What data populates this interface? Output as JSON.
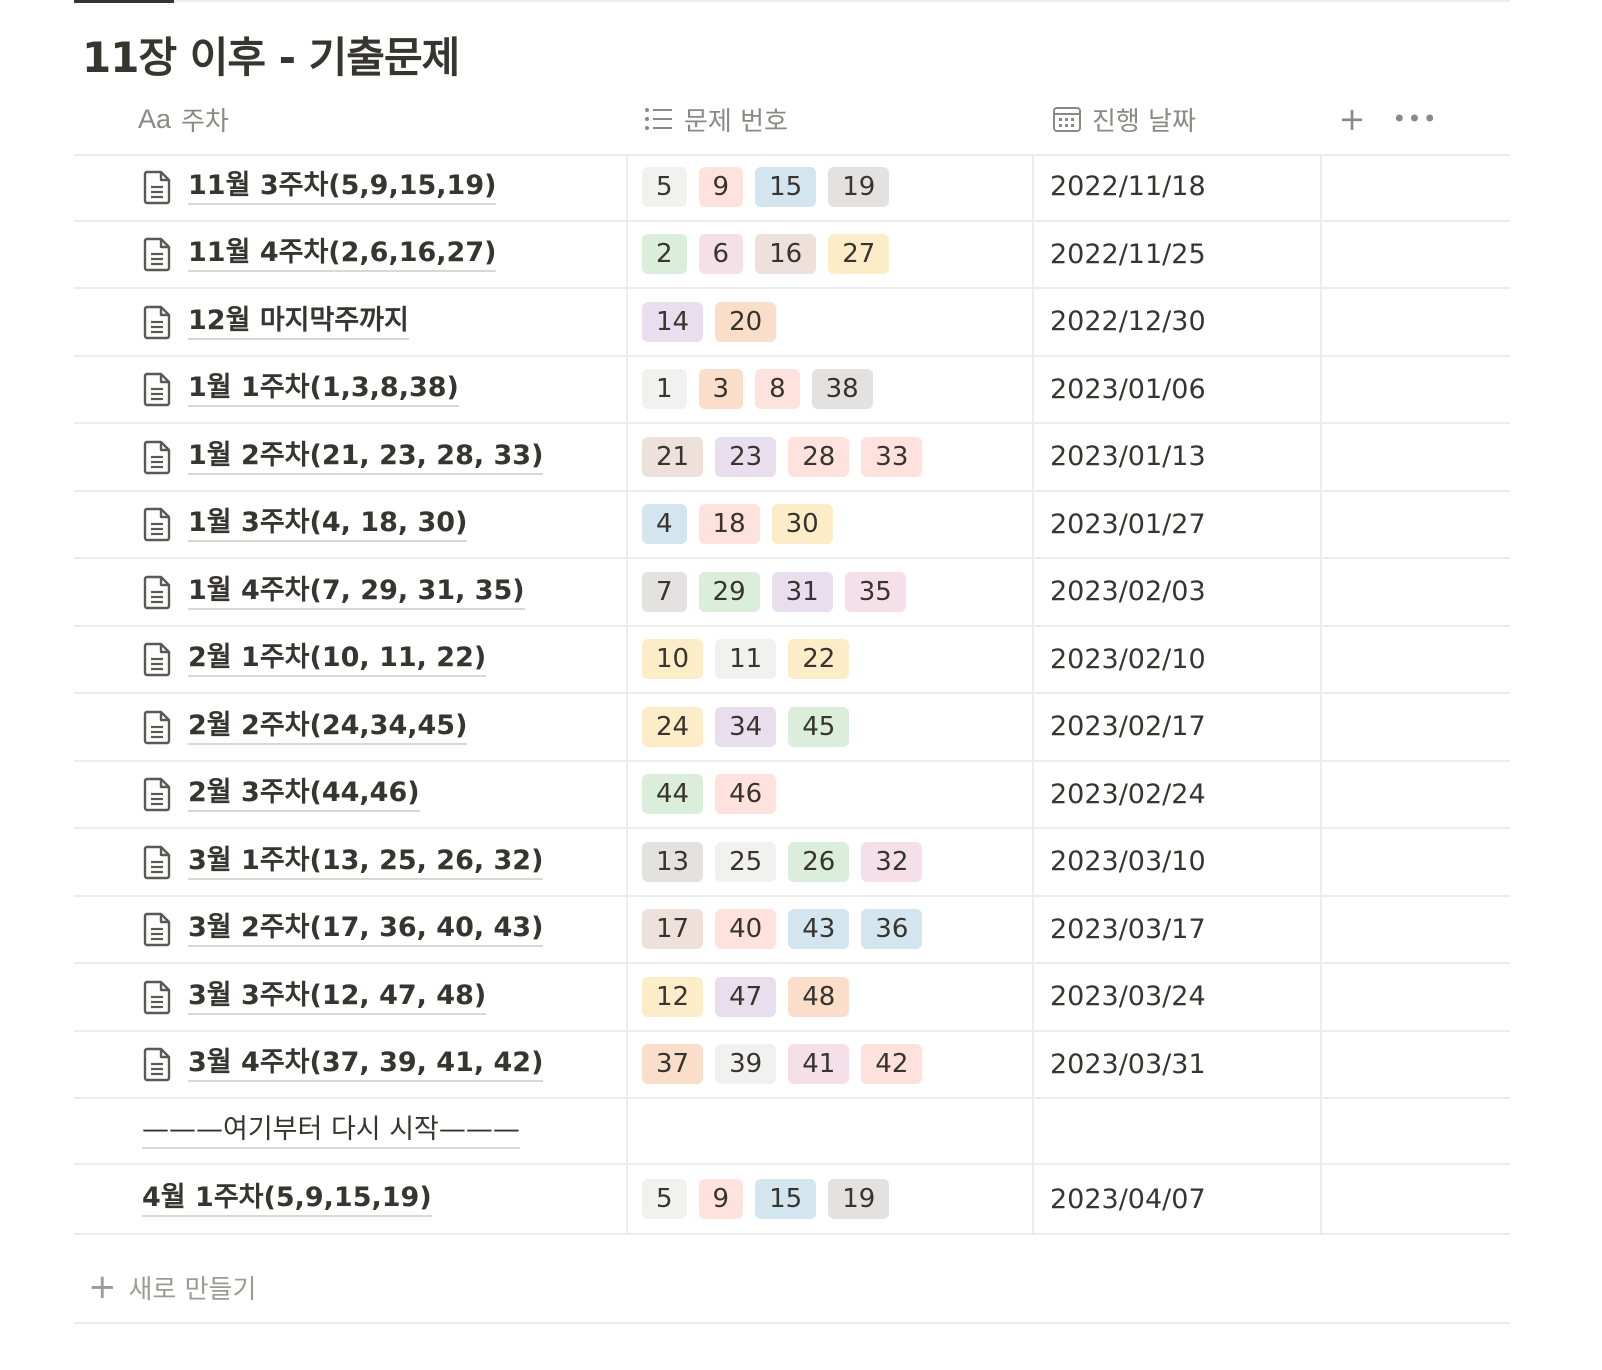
{
  "title": "11장 이후 - 기출문제",
  "header": {
    "col_name_icon_text": "Aa",
    "col_name": "주차",
    "col_problems": "문제 번호",
    "col_date": "진행 날짜",
    "add_label": "+",
    "more_label": "•••"
  },
  "colors": {
    "default": "#f1f1ef",
    "gray": "#e3e2e0",
    "brown": "#eee0da",
    "orange": "#fadec9",
    "yellow": "#fdecc8",
    "green": "#dbeddb",
    "blue": "#d3e5ef",
    "purple": "#e8deee",
    "pink": "#f5e0e9",
    "red": "#ffe2dd"
  },
  "rows": [
    {
      "name": " 11월 3주차(5,9,15,19)",
      "date": "2022/11/18",
      "icon": "page-icon",
      "tags": [
        {
          "label": "5",
          "color": "default"
        },
        {
          "label": "9",
          "color": "red"
        },
        {
          "label": "15",
          "color": "blue"
        },
        {
          "label": "19",
          "color": "gray"
        }
      ]
    },
    {
      "name": "11월 4주차(2,6,16,27)",
      "date": "2022/11/25",
      "icon": "page-icon",
      "tags": [
        {
          "label": "2",
          "color": "green"
        },
        {
          "label": "6",
          "color": "pink"
        },
        {
          "label": "16",
          "color": "brown"
        },
        {
          "label": "27",
          "color": "yellow"
        }
      ]
    },
    {
      "name": "12월 마지막주까지",
      "date": "2022/12/30",
      "icon": "page-icon",
      "tags": [
        {
          "label": "14",
          "color": "purple"
        },
        {
          "label": "20",
          "color": "orange"
        }
      ]
    },
    {
      "name": "1월 1주차(1,3,8,38)",
      "date": "2023/01/06",
      "icon": "page-icon",
      "tags": [
        {
          "label": "1",
          "color": "default"
        },
        {
          "label": "3",
          "color": "orange"
        },
        {
          "label": "8",
          "color": "red"
        },
        {
          "label": "38",
          "color": "gray"
        }
      ]
    },
    {
      "name": "1월 2주차(21, 23, 28, 33)",
      "date": "2023/01/13",
      "icon": "page-icon",
      "tags": [
        {
          "label": "21",
          "color": "brown"
        },
        {
          "label": "23",
          "color": "purple"
        },
        {
          "label": "28",
          "color": "red"
        },
        {
          "label": "33",
          "color": "red"
        }
      ]
    },
    {
      "name": "1월 3주차(4, 18, 30)",
      "date": "2023/01/27",
      "icon": "page-icon",
      "tags": [
        {
          "label": "4",
          "color": "blue"
        },
        {
          "label": "18",
          "color": "red"
        },
        {
          "label": "30",
          "color": "yellow"
        }
      ]
    },
    {
      "name": "1월 4주차(7, 29, 31, 35)",
      "date": "2023/02/03",
      "icon": "page-icon",
      "tags": [
        {
          "label": "7",
          "color": "gray"
        },
        {
          "label": "29",
          "color": "green"
        },
        {
          "label": "31",
          "color": "purple"
        },
        {
          "label": "35",
          "color": "pink"
        }
      ]
    },
    {
      "name": "2월 1주차(10, 11, 22)",
      "date": "2023/02/10",
      "icon": "page-icon",
      "tags": [
        {
          "label": "10",
          "color": "yellow"
        },
        {
          "label": "11",
          "color": "default"
        },
        {
          "label": "22",
          "color": "yellow"
        }
      ]
    },
    {
      "name": "2월 2주차(24,34,45)",
      "date": "2023/02/17",
      "icon": "page-icon",
      "tags": [
        {
          "label": "24",
          "color": "yellow"
        },
        {
          "label": "34",
          "color": "purple"
        },
        {
          "label": "45",
          "color": "green"
        }
      ]
    },
    {
      "name": "2월 3주차(44,46)",
      "date": "2023/02/24",
      "icon": "page-icon",
      "tags": [
        {
          "label": "44",
          "color": "green"
        },
        {
          "label": "46",
          "color": "red"
        }
      ]
    },
    {
      "name": "3월 1주차(13, 25, 26, 32)",
      "date": "2023/03/10",
      "icon": "page-icon",
      "tags": [
        {
          "label": "13",
          "color": "gray"
        },
        {
          "label": "25",
          "color": "default"
        },
        {
          "label": "26",
          "color": "green"
        },
        {
          "label": "32",
          "color": "pink"
        }
      ]
    },
    {
      "name": "3월 2주차(17, 36, 40, 43)",
      "date": "2023/03/17",
      "icon": "page-icon",
      "tags": [
        {
          "label": "17",
          "color": "brown"
        },
        {
          "label": "40",
          "color": "red"
        },
        {
          "label": "43",
          "color": "blue"
        },
        {
          "label": "36",
          "color": "blue"
        }
      ]
    },
    {
      "name": "3월 3주차(12, 47, 48)",
      "date": "2023/03/24",
      "icon": "page-icon",
      "tags": [
        {
          "label": "12",
          "color": "yellow"
        },
        {
          "label": "47",
          "color": "purple"
        },
        {
          "label": "48",
          "color": "orange"
        }
      ]
    },
    {
      "name": "3월 4주차(37, 39, 41, 42)",
      "date": "2023/03/31",
      "icon": "page-icon",
      "tags": [
        {
          "label": "37",
          "color": "orange"
        },
        {
          "label": "39",
          "color": "default"
        },
        {
          "label": "41",
          "color": "pink"
        },
        {
          "label": "42",
          "color": "red"
        }
      ]
    },
    {
      "name": "———여기부터 다시 시작———",
      "date": "",
      "icon": "",
      "plain": true,
      "tags": []
    },
    {
      "name": "4월 1주차(5,9,15,19)",
      "date": "2023/04/07",
      "icon": "",
      "tags": [
        {
          "label": "5",
          "color": "default"
        },
        {
          "label": "9",
          "color": "red"
        },
        {
          "label": "15",
          "color": "blue"
        },
        {
          "label": "19",
          "color": "gray"
        }
      ]
    }
  ],
  "new_row": {
    "plus": "+",
    "label": "새로 만들기"
  }
}
